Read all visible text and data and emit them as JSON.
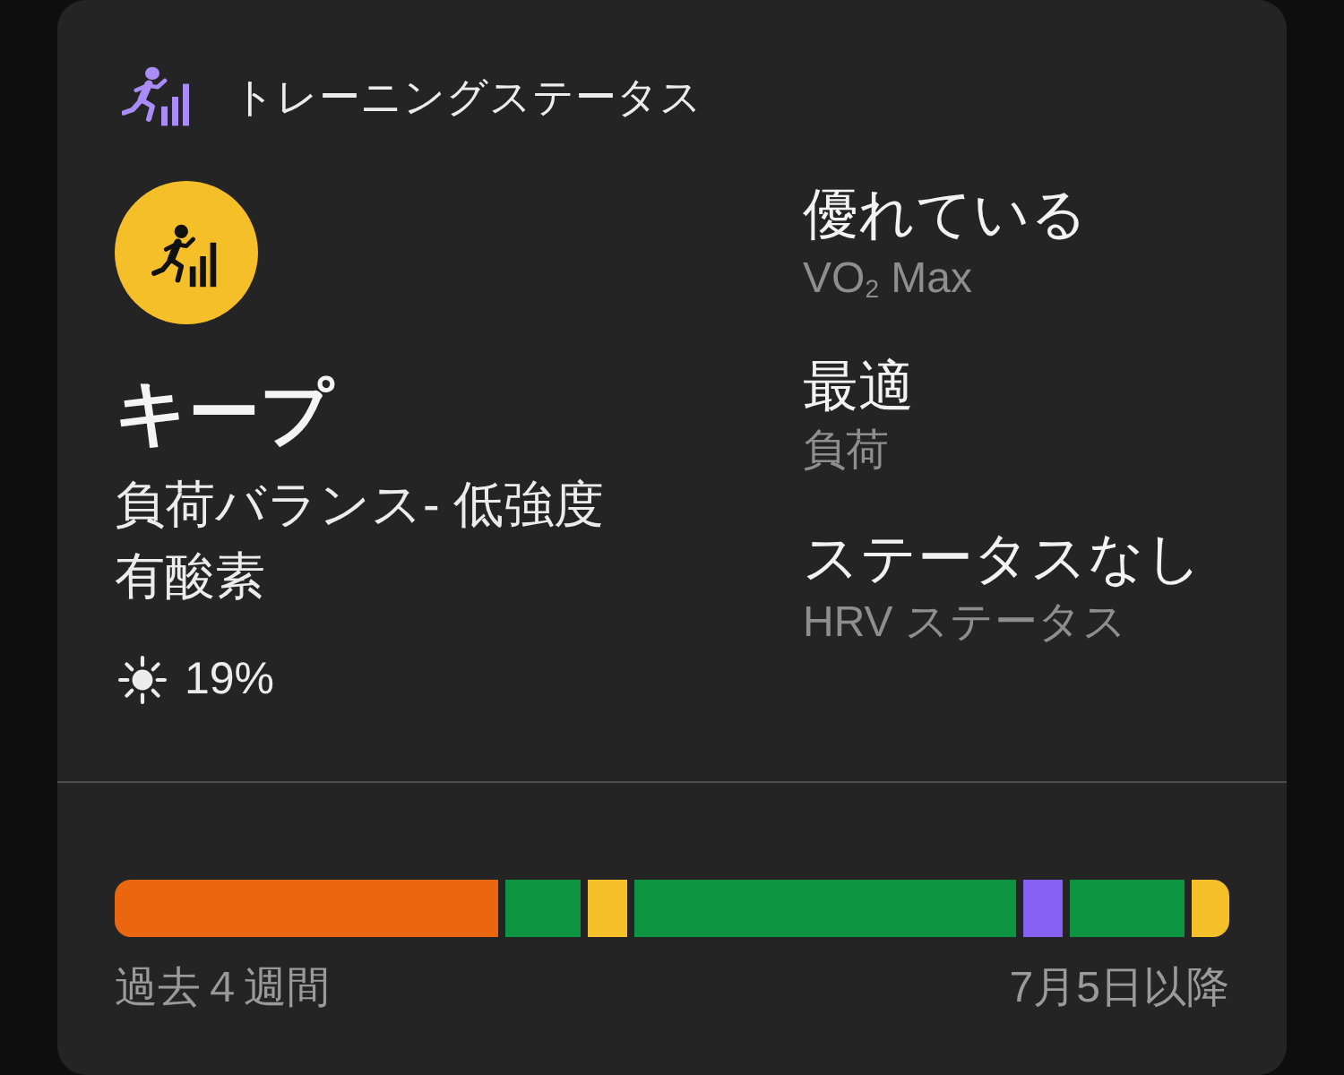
{
  "header": {
    "title": "トレーニングステータス"
  },
  "status": {
    "label": "キープ",
    "details": [
      "負荷バランス- 低強度",
      "有酸素"
    ],
    "change": "19%"
  },
  "metrics": [
    {
      "value": "優れている",
      "label": "VO$_{2}$ Max"
    },
    {
      "value": "最適",
      "label": "負荷"
    },
    {
      "value": "ステータスなし",
      "label": "HRV ステータス"
    }
  ],
  "timeline": {
    "days": [
      {
        "color": "#ea670f"
      },
      {
        "color": "#ea670f"
      },
      {
        "color": "#ea670f"
      },
      {
        "color": "#ea670f"
      },
      {
        "color": "#ea670f"
      },
      {
        "color": "#ea670f"
      },
      {
        "color": "#ea670f"
      },
      {
        "color": "#ea670f"
      },
      {
        "color": "#ea670f"
      },
      {
        "color": "#ea670f"
      },
      {
        "color": "#0c9440"
      },
      {
        "color": "#0c9440"
      },
      {
        "color": "#f5bf2a"
      },
      {
        "color": "#0c9440"
      },
      {
        "color": "#0c9440"
      },
      {
        "color": "#0c9440"
      },
      {
        "color": "#0c9440"
      },
      {
        "color": "#0c9440"
      },
      {
        "color": "#0c9440"
      },
      {
        "color": "#0c9440"
      },
      {
        "color": "#0c9440"
      },
      {
        "color": "#0c9440"
      },
      {
        "color": "#0c9440"
      },
      {
        "color": "#8660f0"
      },
      {
        "color": "#0c9440"
      },
      {
        "color": "#0c9440"
      },
      {
        "color": "#0c9440"
      },
      {
        "color": "#f5bf2a"
      }
    ],
    "start_label": "過去４週間",
    "end_label": "7月5日以降"
  }
}
